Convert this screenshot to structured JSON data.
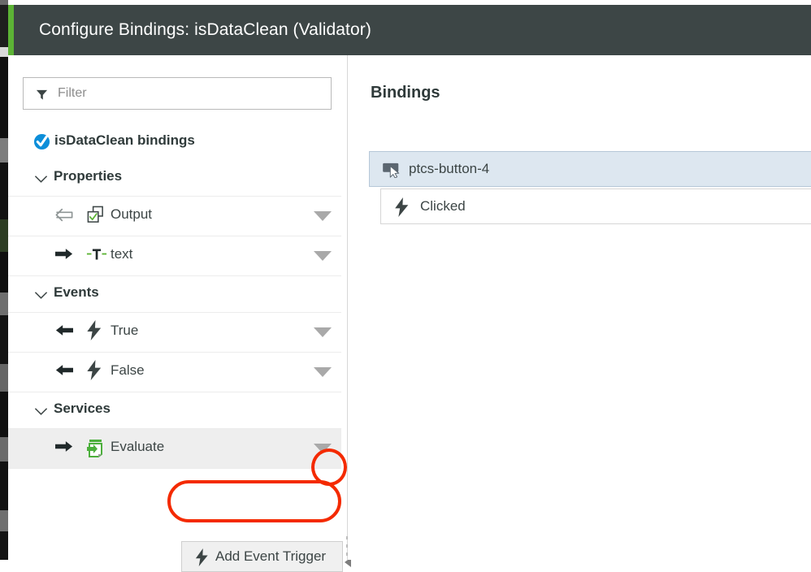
{
  "dialog": {
    "title": "Configure Bindings: isDataClean (Validator)",
    "accent_color": "#5cb335",
    "titlebar_color": "#3d4646"
  },
  "filter": {
    "placeholder": "Filter",
    "value": "",
    "icon": "funnel-icon"
  },
  "tree": {
    "root": {
      "label": "isDataClean bindings",
      "icon": "blue-check-circle-icon"
    },
    "groups": [
      {
        "label": "Properties",
        "expanded": true,
        "chevron": "chevron-down-icon",
        "items": [
          {
            "label": "Output",
            "direction_icon": "arrow-left-outline-icon",
            "type_icon": "boolean-checkbox-icon",
            "caret": "caret-down-icon",
            "selected": false
          },
          {
            "label": "text",
            "direction_icon": "arrow-right-solid-icon",
            "type_icon": "text-type-icon",
            "caret": "caret-down-icon",
            "selected": false
          }
        ]
      },
      {
        "label": "Events",
        "expanded": true,
        "chevron": "chevron-down-icon",
        "items": [
          {
            "label": "True",
            "direction_icon": "arrow-left-solid-icon",
            "type_icon": "lightning-bolt-icon",
            "caret": "caret-down-icon",
            "selected": false
          },
          {
            "label": "False",
            "direction_icon": "arrow-left-solid-icon",
            "type_icon": "lightning-bolt-icon",
            "caret": "caret-down-icon",
            "selected": false
          }
        ]
      },
      {
        "label": "Services",
        "expanded": true,
        "chevron": "chevron-down-icon",
        "items": [
          {
            "label": "Evaluate",
            "direction_icon": "arrow-right-solid-icon",
            "type_icon": "service-icon",
            "caret": "caret-down-icon",
            "selected": true
          }
        ]
      }
    ]
  },
  "dropdown": {
    "open": true,
    "items": [
      {
        "label": "Add Event Trigger",
        "icon": "lightning-bolt-icon"
      }
    ]
  },
  "bindings": {
    "title": "Bindings",
    "parent": {
      "label": "ptcs-button-4",
      "icon": "button-cursor-icon",
      "selected": true
    },
    "child": {
      "label": "Clicked",
      "icon": "lightning-bolt-icon"
    }
  },
  "annotations": {
    "color": "#f42a00",
    "shapes": [
      {
        "name": "caret-highlight",
        "shape": "ellipse"
      },
      {
        "name": "menu-highlight",
        "shape": "rounded-rect"
      }
    ]
  },
  "splitter": {
    "handle": "drag-dots-handle",
    "collapse_icon": "collapse-arrow-icon"
  }
}
